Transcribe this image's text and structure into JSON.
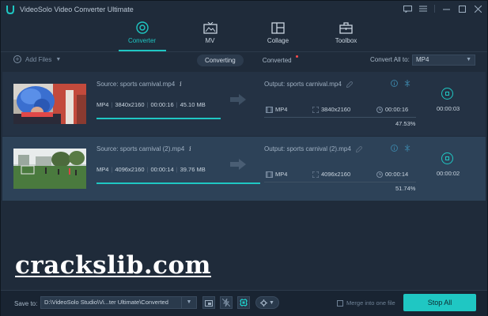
{
  "window": {
    "title": "VideoSolo Video Converter Ultimate"
  },
  "colors": {
    "accent": "#1fc7c3",
    "background": "#1f2b3a",
    "row_selected": "#2d4258",
    "badge": "#ff4c4c"
  },
  "nav": [
    {
      "label": "Converter",
      "icon": "converter-icon"
    },
    {
      "label": "MV",
      "icon": "tv-icon"
    },
    {
      "label": "Collage",
      "icon": "collage-icon"
    },
    {
      "label": "Toolbox",
      "icon": "toolbox-icon"
    }
  ],
  "toolbar": {
    "add_files": "Add Files",
    "tab_converting": "Converting",
    "tab_converted": "Converted",
    "convert_all_label": "Convert All to:",
    "convert_all_value": "MP4"
  },
  "files": [
    {
      "source": "Source: sports carnival.mp4",
      "format": "MP4",
      "resolution": "3840x2160",
      "duration": "00:00:16",
      "size": "45.10 MB",
      "output": "Output: sports carnival.mp4",
      "out_format": "MP4",
      "out_resolution": "3840x2160",
      "out_duration": "00:00:16",
      "progress_percent": 47.53,
      "percent_text": "47.53%",
      "elapsed": "00:00:03"
    },
    {
      "source": "Source: sports carnival (2).mp4",
      "format": "MP4",
      "resolution": "4096x2160",
      "duration": "00:00:14",
      "size": "39.76 MB",
      "output": "Output: sports carnival (2).mp4",
      "out_format": "MP4",
      "out_resolution": "4096x2160",
      "out_duration": "00:00:14",
      "progress_percent": 51.74,
      "percent_text": "51.74%",
      "elapsed": "00:00:02"
    }
  ],
  "watermark": "crackslib.com",
  "bottom": {
    "save_to_label": "Save to:",
    "save_path": "D:\\VideoSolo Studio\\Vi...ter Ultimate\\Converted",
    "merge_label": "Merge into one file",
    "stop_all": "Stop All"
  }
}
